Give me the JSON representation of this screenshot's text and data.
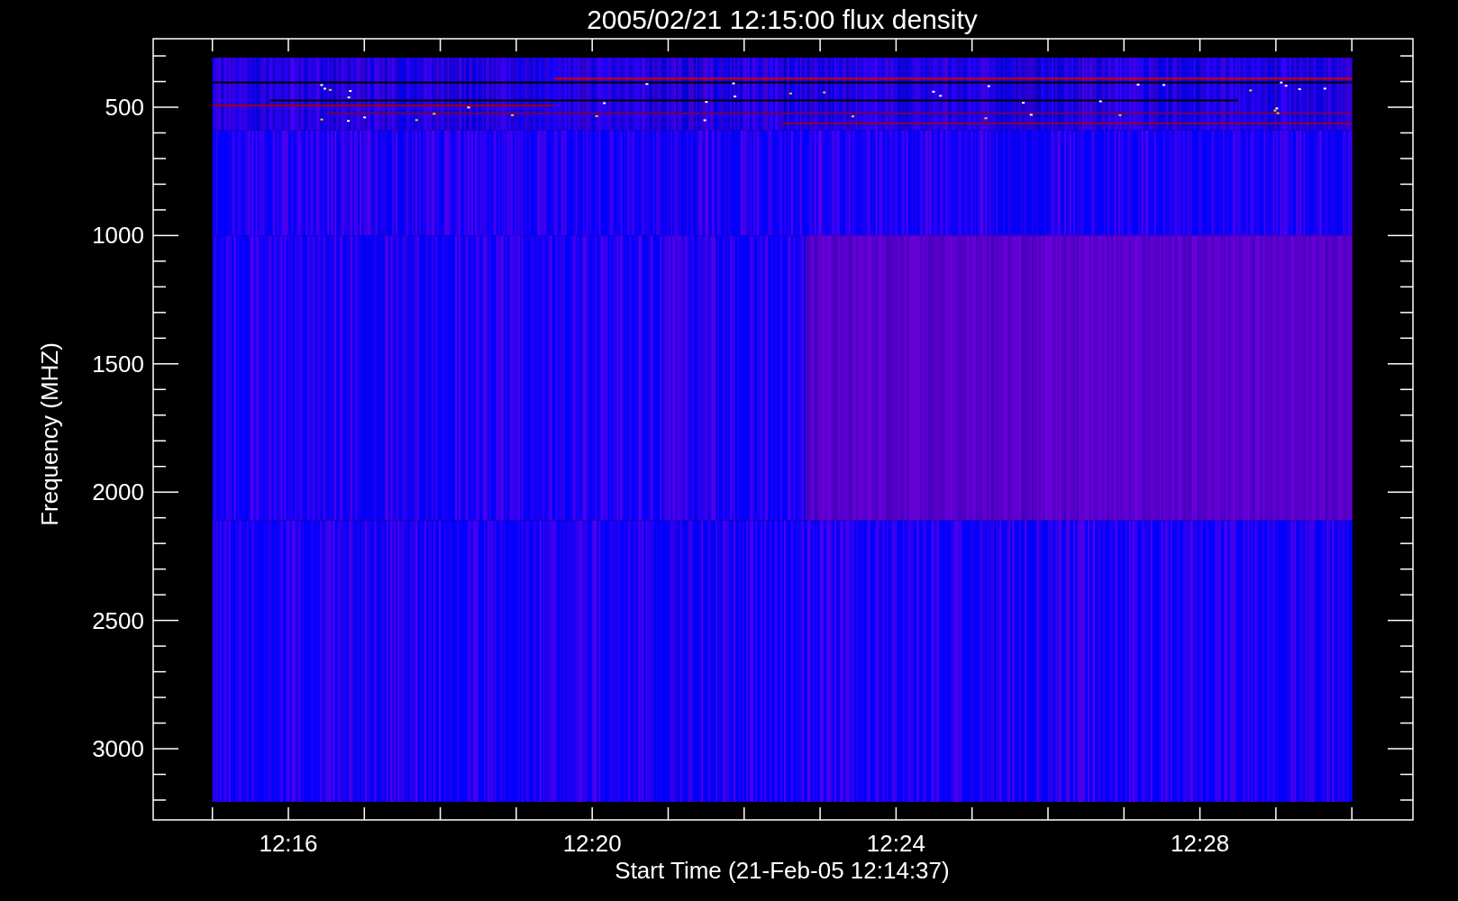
{
  "plot": {
    "title": "2005/02/21 12:15:00 flux density",
    "xlabel": "Start Time (21-Feb-05 12:14:37)",
    "ylabel": "Frequency (MHZ)",
    "yticks": [
      "500",
      "1000",
      "1500",
      "2000",
      "2500",
      "3000"
    ],
    "xticks": [
      "12:16",
      "12:20",
      "12:24",
      "12:28"
    ]
  }
}
